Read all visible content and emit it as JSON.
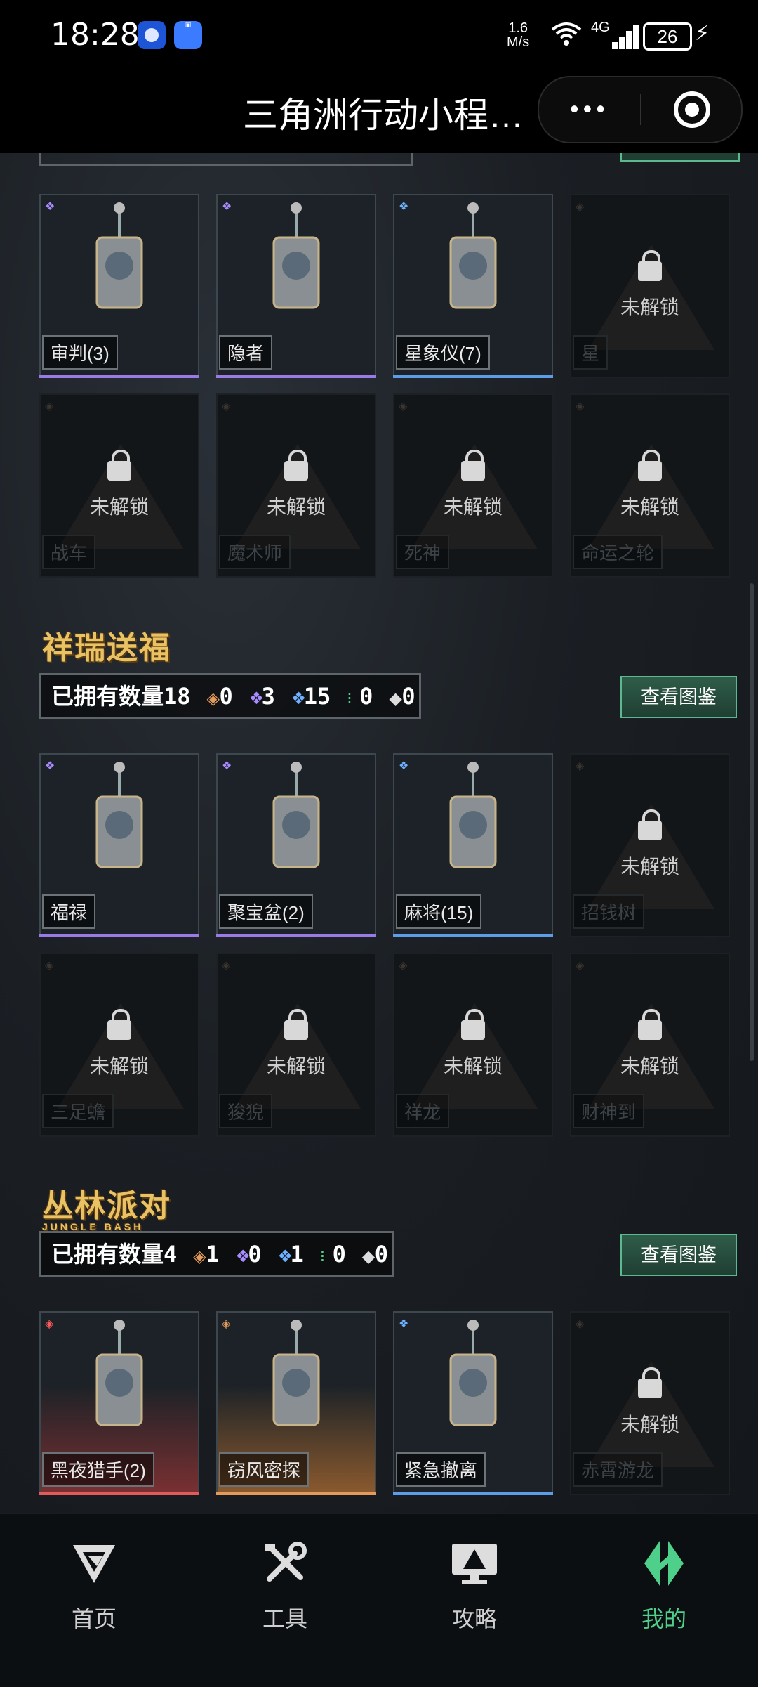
{
  "status": {
    "time": "18:28",
    "speed_top": "1.6",
    "speed_bottom": "M/s",
    "network": "4G",
    "signal_prefix": "6",
    "battery": "26"
  },
  "title": {
    "text": "三角洲行动小程…"
  },
  "sections": [
    {
      "id": "tarot",
      "items": [
        {
          "label": "审判(3)",
          "rarity": "purple",
          "locked": false
        },
        {
          "label": "隐者",
          "rarity": "purple",
          "locked": false
        },
        {
          "label": "星象仪(7)",
          "rarity": "blue",
          "locked": false
        },
        {
          "label": "星",
          "rarity": "orange",
          "locked": true
        },
        {
          "label": "战车",
          "rarity": "orange",
          "locked": true
        },
        {
          "label": "魔术师",
          "rarity": "orange",
          "locked": true
        },
        {
          "label": "死神",
          "rarity": "orange",
          "locked": true
        },
        {
          "label": "命运之轮",
          "rarity": "orange",
          "locked": true
        }
      ]
    },
    {
      "id": "auspicious",
      "banner": "祥瑞送福",
      "owned_label": "已拥有数量18",
      "counts": {
        "orange": "0",
        "purple": "3",
        "blue": "15",
        "green": "0",
        "white": "0"
      },
      "view_button": "查看图鉴",
      "items": [
        {
          "label": "福禄",
          "rarity": "purple",
          "locked": false
        },
        {
          "label": "聚宝盆(2)",
          "rarity": "purple",
          "locked": false
        },
        {
          "label": "麻将(15)",
          "rarity": "blue",
          "locked": false
        },
        {
          "label": "招钱树",
          "rarity": "orange",
          "locked": true
        },
        {
          "label": "三足蟾",
          "rarity": "orange",
          "locked": true
        },
        {
          "label": "狻猊",
          "rarity": "orange",
          "locked": true
        },
        {
          "label": "祥龙",
          "rarity": "orange",
          "locked": true
        },
        {
          "label": "财神到",
          "rarity": "orange",
          "locked": true
        }
      ]
    },
    {
      "id": "jungle",
      "banner": "丛林派对",
      "banner_sub": "JUNGLE BASH",
      "owned_label": "已拥有数量4",
      "counts": {
        "orange": "1",
        "purple": "0",
        "blue": "1",
        "green": "0",
        "white": "0"
      },
      "view_button": "查看图鉴",
      "items": [
        {
          "label": "黑夜猎手(2)",
          "rarity": "red",
          "locked": false
        },
        {
          "label": "窃风密探",
          "rarity": "orange",
          "locked": false
        },
        {
          "label": "紧急撤离",
          "rarity": "blue",
          "locked": false
        },
        {
          "label": "赤霄游龙",
          "rarity": "orange",
          "locked": true
        }
      ]
    }
  ],
  "locked_text": "未解锁",
  "tabs": [
    {
      "label": "首页",
      "icon": "home-logo-icon",
      "active": false
    },
    {
      "label": "工具",
      "icon": "tools-icon",
      "active": false
    },
    {
      "label": "攻略",
      "icon": "guide-monitor-icon",
      "active": false
    },
    {
      "label": "我的",
      "icon": "profile-logo-icon",
      "active": true
    }
  ],
  "colors": {
    "accent": "#4fd08a",
    "purple": "#9a7be6",
    "blue": "#5d9ce6",
    "orange": "#e39a5a",
    "red": "#e25b5b"
  }
}
